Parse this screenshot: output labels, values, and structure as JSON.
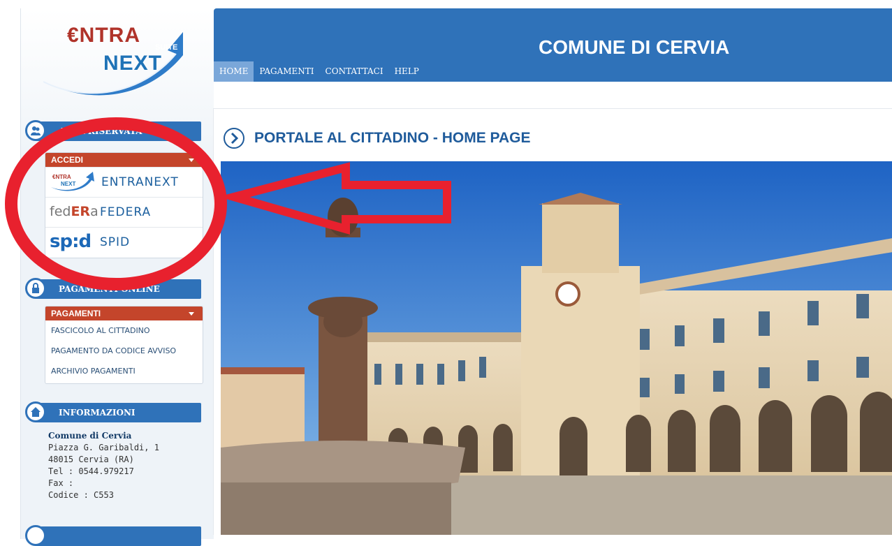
{
  "logo": {
    "word1": "€NTRA",
    "word2": "NEXT",
    "suite": "SUITE"
  },
  "header": {
    "city": "COMUNE DI CERVIA",
    "nav": [
      "HOME",
      "PAGAMENTI",
      "CONTATTACI",
      "HELP"
    ]
  },
  "sidebar": {
    "reserved": {
      "title": "AREA RISERVATA",
      "panel_title": "ACCEDI",
      "options": [
        {
          "label": "ENTRANEXT",
          "icon": "entranext-logo-icon"
        },
        {
          "label": "FEDERA",
          "brand": "fedERa",
          "icon": "federa-logo-icon"
        },
        {
          "label": "SPID",
          "brand": "sp:d",
          "icon": "spid-logo-icon"
        }
      ]
    },
    "payments": {
      "title": "PAGAMENTI ONLINE",
      "panel_title": "PAGAMENTI",
      "links": [
        "FASCICOLO AL CITTADINO",
        "PAGAMENTO DA CODICE AVVISO",
        "ARCHIVIO PAGAMENTI"
      ]
    },
    "info": {
      "title": "INFORMAZIONI",
      "name": "Comune di Cervia",
      "address": "Piazza G. Garibaldi, 1",
      "city": "48015 Cervia (RA)",
      "tel": "Tel : 0544.979217",
      "fax": "Fax :",
      "code": "Codice : C553"
    }
  },
  "content": {
    "page_title": "PORTALE AL CITTADINO - HOME PAGE"
  },
  "colors": {
    "primary": "#2f72b9",
    "accent": "#c4452b",
    "annotation": "#e8212e"
  }
}
